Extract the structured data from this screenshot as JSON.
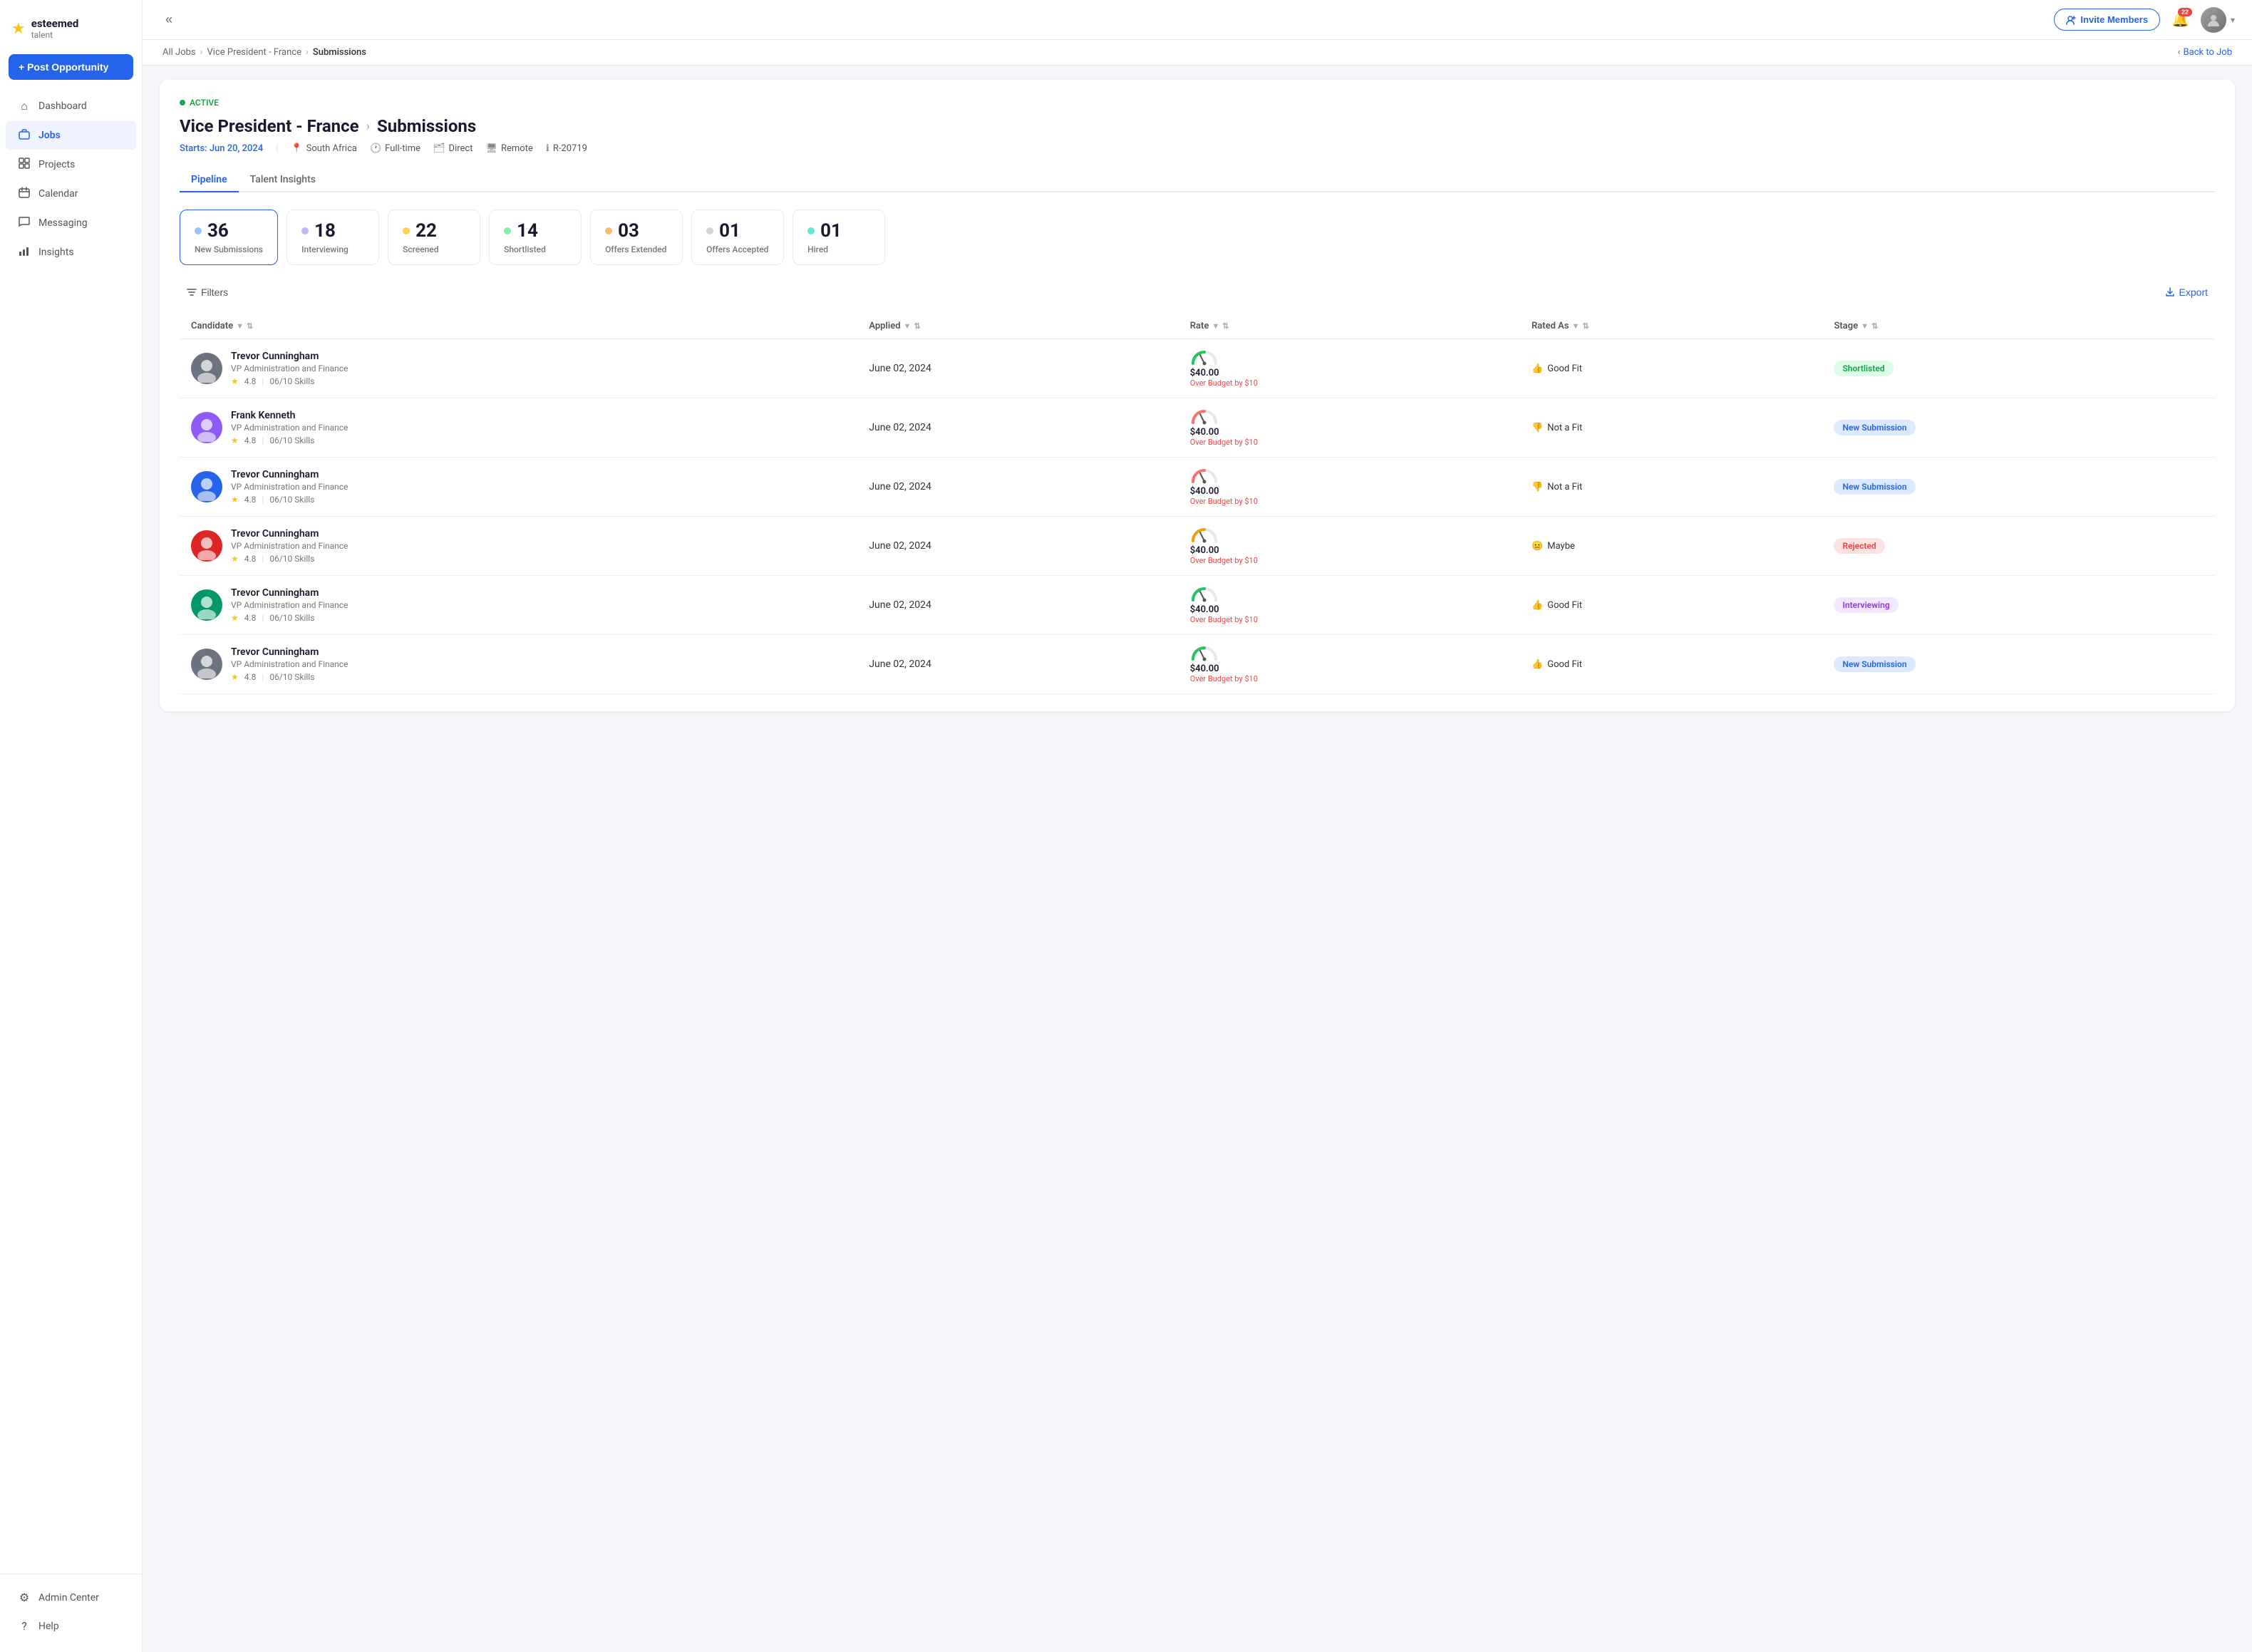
{
  "app": {
    "logo_star": "★",
    "logo_name": "esteemed",
    "logo_tagline": "talent"
  },
  "sidebar": {
    "post_opportunity_label": "+ Post Opportunity",
    "nav_items": [
      {
        "id": "dashboard",
        "label": "Dashboard",
        "icon": "⌂"
      },
      {
        "id": "jobs",
        "label": "Jobs",
        "icon": "💼",
        "active": true
      },
      {
        "id": "projects",
        "label": "Projects",
        "icon": "◫"
      },
      {
        "id": "calendar",
        "label": "Calendar",
        "icon": "📅"
      },
      {
        "id": "messaging",
        "label": "Messaging",
        "icon": "💬"
      },
      {
        "id": "insights",
        "label": "Insights",
        "icon": "📊"
      }
    ],
    "bottom_items": [
      {
        "id": "admin",
        "label": "Admin Center",
        "icon": "⚙"
      },
      {
        "id": "help",
        "label": "Help",
        "icon": "?"
      }
    ]
  },
  "topbar": {
    "invite_label": "Invite Members",
    "notif_count": "22",
    "chevron": "▾"
  },
  "breadcrumb": {
    "all_jobs": "All Jobs",
    "job_name": "Vice President - France",
    "current": "Submissions",
    "back_label": "Back to Job"
  },
  "job": {
    "status": "ACTIVE",
    "title": "Vice President -  France",
    "section": "Submissions",
    "starts_label": "Starts:",
    "start_date": "Jun 20, 2024",
    "location": "South Africa",
    "type": "Full-time",
    "mode": "Direct",
    "remote": "Remote",
    "ref": "R-20719"
  },
  "tabs": [
    {
      "id": "pipeline",
      "label": "Pipeline",
      "active": true
    },
    {
      "id": "talent-insights",
      "label": "Talent Insights",
      "active": false
    }
  ],
  "pipeline_cards": [
    {
      "id": "new-submissions",
      "count": "36",
      "label": "New Submissions",
      "dot": "blue",
      "active": true
    },
    {
      "id": "interviewing",
      "count": "18",
      "label": "Interviewing",
      "dot": "purple",
      "active": false
    },
    {
      "id": "screened",
      "count": "22",
      "label": "Screened",
      "dot": "yellow",
      "active": false
    },
    {
      "id": "shortlisted",
      "count": "14",
      "label": "Shortlisted",
      "dot": "green",
      "active": false
    },
    {
      "id": "offers-extended",
      "count": "03",
      "label": "Offers Extended",
      "dot": "orange",
      "active": false
    },
    {
      "id": "offers-accepted",
      "count": "01",
      "label": "Offers Accepted",
      "dot": "gray",
      "active": false
    },
    {
      "id": "hired",
      "count": "01",
      "label": "Hired",
      "dot": "teal",
      "active": false
    }
  ],
  "toolbar": {
    "filters_label": "Filters",
    "export_label": "Export"
  },
  "table": {
    "columns": [
      {
        "id": "candidate",
        "label": "Candidate"
      },
      {
        "id": "applied",
        "label": "Applied"
      },
      {
        "id": "rate",
        "label": "Rate"
      },
      {
        "id": "rated-as",
        "label": "Rated As"
      },
      {
        "id": "stage",
        "label": "Stage"
      }
    ],
    "rows": [
      {
        "id": "row-1",
        "name": "Trevor Cunningham",
        "role": "VP Administration and Finance",
        "rating": "4.8",
        "skills": "06/10 Skills",
        "applied": "June 02, 2024",
        "rate_amount": "$40.00",
        "rate_over": "Over Budget by $10",
        "rated_as": "Good Fit",
        "rated_type": "good",
        "stage": "Shortlisted",
        "stage_type": "shortlisted"
      },
      {
        "id": "row-2",
        "name": "Frank Kenneth",
        "role": "VP Administration and Finance",
        "rating": "4.8",
        "skills": "06/10 Skills",
        "applied": "June 02, 2024",
        "rate_amount": "$40.00",
        "rate_over": "Over Budget by $10",
        "rated_as": "Not a Fit",
        "rated_type": "not-fit",
        "stage": "New Submission",
        "stage_type": "new-submission"
      },
      {
        "id": "row-3",
        "name": "Trevor Cunningham",
        "role": "VP Administration and Finance",
        "rating": "4.8",
        "skills": "06/10 Skills",
        "applied": "June 02, 2024",
        "rate_amount": "$40.00",
        "rate_over": "Over Budget by $10",
        "rated_as": "Not a Fit",
        "rated_type": "not-fit",
        "stage": "New Submission",
        "stage_type": "new-submission"
      },
      {
        "id": "row-4",
        "name": "Trevor Cunningham",
        "role": "VP Administration and Finance",
        "rating": "4.8",
        "skills": "06/10 Skills",
        "applied": "June 02, 2024",
        "rate_amount": "$40.00",
        "rate_over": "Over Budget by $10",
        "rated_as": "Maybe",
        "rated_type": "maybe",
        "stage": "Rejected",
        "stage_type": "rejected"
      },
      {
        "id": "row-5",
        "name": "Trevor Cunningham",
        "role": "VP Administration and Finance",
        "rating": "4.8",
        "skills": "06/10 Skills",
        "applied": "June 02, 2024",
        "rate_amount": "$40.00",
        "rate_over": "Over Budget by $10",
        "rated_as": "Good Fit",
        "rated_type": "good",
        "stage": "Interviewing",
        "stage_type": "interviewing"
      },
      {
        "id": "row-6",
        "name": "Trevor Cunningham",
        "role": "VP Administration and Finance",
        "rating": "4.8",
        "skills": "06/10 Skills",
        "applied": "June 02, 2024",
        "rate_amount": "$40.00",
        "rate_over": "Over Budget by $10",
        "rated_as": "Good Fit",
        "rated_type": "good",
        "stage": "New Submission",
        "stage_type": "new-submission"
      }
    ]
  }
}
